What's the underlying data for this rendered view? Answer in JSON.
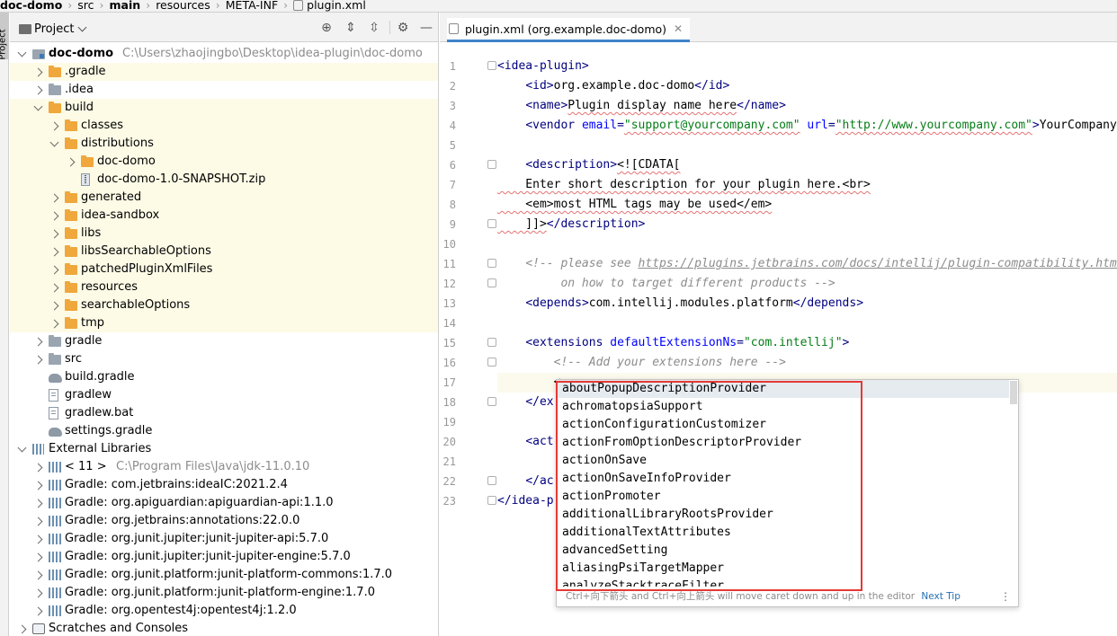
{
  "breadcrumb": {
    "items": [
      "doc-domo",
      "src",
      "main",
      "resources",
      "META-INF",
      "plugin.xml"
    ]
  },
  "side_stripe": {
    "label": "Project"
  },
  "project_panel": {
    "title": "Project",
    "tree": [
      {
        "label": "doc-domo",
        "path": "C:\\Users\\zhaojingbo\\Desktop\\idea-plugin\\doc-domo",
        "icon": "module-icon",
        "depth": 0,
        "expanded": true,
        "bold": true
      },
      {
        "label": ".gradle",
        "icon": "folder-icon",
        "depth": 1,
        "expanded": false,
        "yellow": true
      },
      {
        "label": ".idea",
        "icon": "folder-grey-icon",
        "depth": 1,
        "expanded": false
      },
      {
        "label": "build",
        "icon": "folder-icon",
        "depth": 1,
        "expanded": true,
        "yellow": true
      },
      {
        "label": "classes",
        "icon": "folder-icon",
        "depth": 2,
        "expanded": false,
        "yellow": true
      },
      {
        "label": "distributions",
        "icon": "folder-icon",
        "depth": 2,
        "expanded": true,
        "yellow": true
      },
      {
        "label": "doc-domo",
        "icon": "folder-icon",
        "depth": 3,
        "expanded": false,
        "yellow": true
      },
      {
        "label": "doc-domo-1.0-SNAPSHOT.zip",
        "icon": "zip-icon",
        "depth": 3,
        "leaf": true,
        "yellow": true
      },
      {
        "label": "generated",
        "icon": "folder-icon",
        "depth": 2,
        "expanded": false,
        "yellow": true
      },
      {
        "label": "idea-sandbox",
        "icon": "folder-icon",
        "depth": 2,
        "expanded": false,
        "yellow": true
      },
      {
        "label": "libs",
        "icon": "folder-icon",
        "depth": 2,
        "expanded": false,
        "yellow": true
      },
      {
        "label": "libsSearchableOptions",
        "icon": "folder-icon",
        "depth": 2,
        "expanded": false,
        "yellow": true
      },
      {
        "label": "patchedPluginXmlFiles",
        "icon": "folder-icon",
        "depth": 2,
        "expanded": false,
        "yellow": true
      },
      {
        "label": "resources",
        "icon": "folder-icon",
        "depth": 2,
        "expanded": false,
        "yellow": true
      },
      {
        "label": "searchableOptions",
        "icon": "folder-icon",
        "depth": 2,
        "expanded": false,
        "yellow": true
      },
      {
        "label": "tmp",
        "icon": "folder-icon",
        "depth": 2,
        "expanded": false,
        "yellow": true
      },
      {
        "label": "gradle",
        "icon": "folder-grey-icon",
        "depth": 1,
        "expanded": false
      },
      {
        "label": "src",
        "icon": "folder-grey-icon",
        "depth": 1,
        "expanded": false
      },
      {
        "label": "build.gradle",
        "icon": "gradle-icon",
        "depth": 1,
        "leaf": true
      },
      {
        "label": "gradlew",
        "icon": "file-icon",
        "depth": 1,
        "leaf": true
      },
      {
        "label": "gradlew.bat",
        "icon": "file-icon",
        "depth": 1,
        "leaf": true
      },
      {
        "label": "settings.gradle",
        "icon": "gradle-icon",
        "depth": 1,
        "leaf": true
      },
      {
        "label": "External Libraries",
        "icon": "libraries-icon",
        "depth": 0,
        "expanded": true
      },
      {
        "label": "< 11 >",
        "path": "C:\\Program Files\\Java\\jdk-11.0.10",
        "icon": "library-icon",
        "depth": 1,
        "expanded": false
      },
      {
        "label": "Gradle: com.jetbrains:ideaIC:2021.2.4",
        "icon": "library-icon",
        "depth": 1,
        "expanded": false
      },
      {
        "label": "Gradle: org.apiguardian:apiguardian-api:1.1.0",
        "icon": "library-icon",
        "depth": 1,
        "expanded": false
      },
      {
        "label": "Gradle: org.jetbrains:annotations:22.0.0",
        "icon": "library-icon",
        "depth": 1,
        "expanded": false
      },
      {
        "label": "Gradle: org.junit.jupiter:junit-jupiter-api:5.7.0",
        "icon": "library-icon",
        "depth": 1,
        "expanded": false
      },
      {
        "label": "Gradle: org.junit.jupiter:junit-jupiter-engine:5.7.0",
        "icon": "library-icon",
        "depth": 1,
        "expanded": false
      },
      {
        "label": "Gradle: org.junit.platform:junit-platform-commons:1.7.0",
        "icon": "library-icon",
        "depth": 1,
        "expanded": false
      },
      {
        "label": "Gradle: org.junit.platform:junit-platform-engine:1.7.0",
        "icon": "library-icon",
        "depth": 1,
        "expanded": false
      },
      {
        "label": "Gradle: org.opentest4j:opentest4j:1.2.0",
        "icon": "library-icon",
        "depth": 1,
        "expanded": false
      },
      {
        "label": "Scratches and Consoles",
        "icon": "scratches-icon",
        "depth": 0,
        "expanded": false
      }
    ]
  },
  "editor": {
    "tab_label": "plugin.xml (org.example.doc-domo)",
    "line_numbers": [
      "1",
      "2",
      "3",
      "4",
      "5",
      "6",
      "7",
      "8",
      "9",
      "10",
      "11",
      "12",
      "13",
      "14",
      "15",
      "16",
      "17",
      "18",
      "19",
      "20",
      "21",
      "22",
      "23"
    ],
    "lines": [
      [
        [
          "t",
          "<"
        ],
        [
          "g",
          "idea-plugin"
        ],
        [
          "t",
          ">"
        ]
      ],
      [
        [
          "s",
          "    "
        ],
        [
          "t",
          "<"
        ],
        [
          "g",
          "id"
        ],
        [
          "t",
          ">"
        ],
        [
          "x",
          "org.example.doc-domo"
        ],
        [
          "t",
          "</"
        ],
        [
          "g",
          "id"
        ],
        [
          "t",
          ">"
        ]
      ],
      [
        [
          "s",
          "    "
        ],
        [
          "t",
          "<"
        ],
        [
          "g",
          "name"
        ],
        [
          "t",
          ">"
        ],
        [
          "xs",
          "Plugin display name here"
        ],
        [
          "t",
          "</"
        ],
        [
          "g",
          "name"
        ],
        [
          "t",
          ">"
        ]
      ],
      [
        [
          "s",
          "    "
        ],
        [
          "t",
          "<"
        ],
        [
          "g",
          "vendor"
        ],
        [
          "s",
          " "
        ],
        [
          "a",
          "email"
        ],
        [
          "t",
          "="
        ],
        [
          "vs",
          "\"support@yourcompany.com\""
        ],
        [
          "s",
          " "
        ],
        [
          "a",
          "url"
        ],
        [
          "t",
          "="
        ],
        [
          "vs",
          "\"http://www.yourcompany.com\""
        ],
        [
          "t",
          ">"
        ],
        [
          "x",
          "YourCompany"
        ]
      ],
      [],
      [
        [
          "s",
          "    "
        ],
        [
          "t",
          "<"
        ],
        [
          "g",
          "description"
        ],
        [
          "t",
          ">"
        ],
        [
          "xs",
          "<![CDATA["
        ]
      ],
      [
        [
          "xs",
          "    Enter short description for your plugin here.<br>"
        ]
      ],
      [
        [
          "xs",
          "    <em>most HTML tags may be used</em>"
        ]
      ],
      [
        [
          "xs",
          "    ]]>"
        ],
        [
          "t",
          "</"
        ],
        [
          "g",
          "description"
        ],
        [
          "t",
          ">"
        ]
      ],
      [],
      [
        [
          "s",
          "    "
        ],
        [
          "c",
          "<!-- please see "
        ],
        [
          "l",
          "https://plugins.jetbrains.com/docs/intellij/plugin-compatibility.html"
        ]
      ],
      [
        [
          "c",
          "         on how to target different products -->"
        ]
      ],
      [
        [
          "s",
          "    "
        ],
        [
          "t",
          "<"
        ],
        [
          "g",
          "depends"
        ],
        [
          "t",
          ">"
        ],
        [
          "x",
          "com.intellij.modules.platform"
        ],
        [
          "t",
          "</"
        ],
        [
          "g",
          "depends"
        ],
        [
          "t",
          ">"
        ]
      ],
      [],
      [
        [
          "s",
          "    "
        ],
        [
          "t",
          "<"
        ],
        [
          "g",
          "extensions"
        ],
        [
          "s",
          " "
        ],
        [
          "a",
          "defaultExtensionNs"
        ],
        [
          "t",
          "="
        ],
        [
          "v",
          "\"com.intellij\""
        ],
        [
          "t",
          ">"
        ]
      ],
      [
        [
          "s",
          "        "
        ],
        [
          "c",
          "<!-- Add your extensions here -->"
        ]
      ],
      [
        [
          "s",
          "        "
        ],
        [
          "x",
          "<"
        ]
      ],
      [
        [
          "s",
          "    "
        ],
        [
          "t",
          "</"
        ],
        [
          "g",
          "ex"
        ]
      ],
      [],
      [
        [
          "s",
          "    "
        ],
        [
          "t",
          "<"
        ],
        [
          "g",
          "act"
        ]
      ],
      [],
      [
        [
          "s",
          "    "
        ],
        [
          "t",
          "</"
        ],
        [
          "g",
          "ac"
        ]
      ],
      [
        [
          "t",
          "</"
        ],
        [
          "g",
          "idea-p"
        ]
      ]
    ],
    "current_line": 17,
    "fold_lines": [
      1,
      6,
      9,
      11,
      12,
      15,
      16,
      18,
      22,
      23
    ]
  },
  "completion_popup": {
    "items": [
      "aboutPopupDescriptionProvider",
      "achromatopsiaSupport",
      "actionConfigurationCustomizer",
      "actionFromOptionDescriptorProvider",
      "actionOnSave",
      "actionOnSaveInfoProvider",
      "actionPromoter",
      "additionalLibraryRootsProvider",
      "additionalTextAttributes",
      "advancedSetting",
      "aliasingPsiTargetMapper",
      "analyzeStacktraceFilter"
    ],
    "selected_index": 0,
    "footer_hint": "Ctrl+向下箭头 and Ctrl+向上箭头 will move caret down and up in the editor",
    "next_tip": "Next Tip"
  },
  "colors": {
    "tag": "#000080",
    "attribute": "#0000ff",
    "value": "#067d17",
    "comment": "#8c8c8c",
    "highlight_box": "#e53935",
    "folder": "#f0a73c"
  }
}
